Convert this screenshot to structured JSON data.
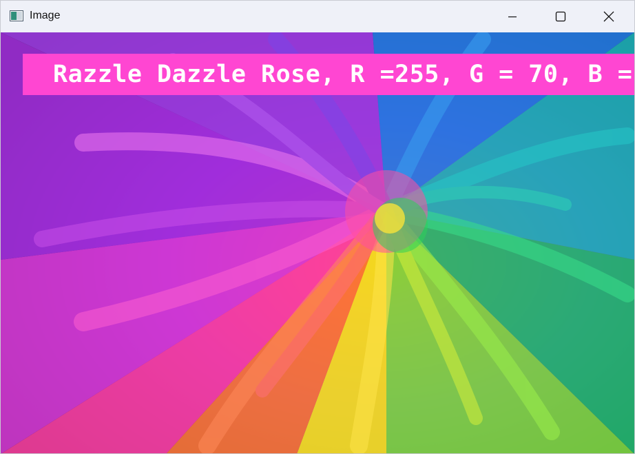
{
  "window": {
    "title": "Image",
    "controls": {
      "minimize": "minimize-icon",
      "maximize": "maximize-icon",
      "close": "close-icon"
    }
  },
  "image": {
    "banner_text": "Razzle Dazzle Rose, R =255, G = 70, B =",
    "banner_color": "#ff46d2",
    "text_color": "#ffffff"
  }
}
